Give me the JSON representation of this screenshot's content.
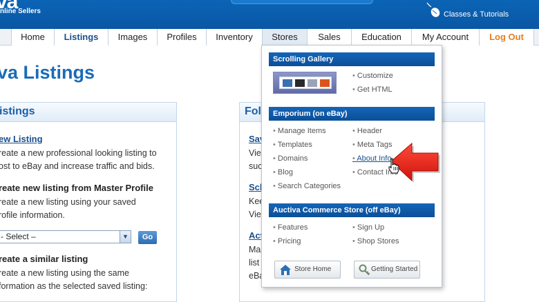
{
  "header": {
    "logo_text": "va",
    "logo_sub": "nline Sellers",
    "classes_link": "Classes & Tutorials"
  },
  "nav": {
    "tabs": [
      "Home",
      "Listings",
      "Images",
      "Profiles",
      "Inventory",
      "Stores",
      "Sales",
      "Education",
      "My Account",
      "Log Out"
    ]
  },
  "page": {
    "title": "va Listings"
  },
  "left_panel": {
    "heading": "istings",
    "new_listing_link": "ew Listing",
    "new_listing_desc1": "reate a new professional looking listing to",
    "new_listing_desc2": "ost to eBay and increase traffic and bids.",
    "master_title": "reate new listing from Master Profile",
    "master_desc1": "reate a new listing using your saved",
    "master_desc2": "rofile information.",
    "select_value": "- Select –",
    "go_label": "Go",
    "similar_title": "reate a similar listing",
    "similar_desc1": "reate a new listing using the same",
    "similar_desc2": "formation as the selected saved listing:"
  },
  "right_panel": {
    "heading": "Fol",
    "items": [
      {
        "link": "Sav",
        "lines": [
          "Vie",
          "suc"
        ]
      },
      {
        "link": "Sch",
        "lines": [
          "Kee",
          "Vie"
        ]
      },
      {
        "link": "Act",
        "lines": [
          "Ma",
          "list",
          "eBa"
        ]
      }
    ]
  },
  "dropdown": {
    "gallery_heading": "Scrolling Gallery",
    "gallery_items": [
      "Customize",
      "Get HTML"
    ],
    "emporium_heading": "Emporium (on eBay)",
    "emporium_left": [
      "Manage Items",
      "Templates",
      "Domains",
      "Blog",
      "Search Categories"
    ],
    "emporium_right": [
      "Header",
      "Meta Tags",
      "About Info",
      "Contact Info"
    ],
    "commerce_heading": "Auctiva Commerce Store (off eBay)",
    "commerce_left": [
      "Features",
      "Pricing"
    ],
    "commerce_right": [
      "Sign Up",
      "Shop Stores"
    ],
    "store_home": "Store Home",
    "getting_started": "Getting Started"
  },
  "colors": {
    "brand_blue": "#0b64b6",
    "link_blue": "#1a4f8c",
    "logout_orange": "#e67e22",
    "arrow_red": "#e8201a"
  }
}
